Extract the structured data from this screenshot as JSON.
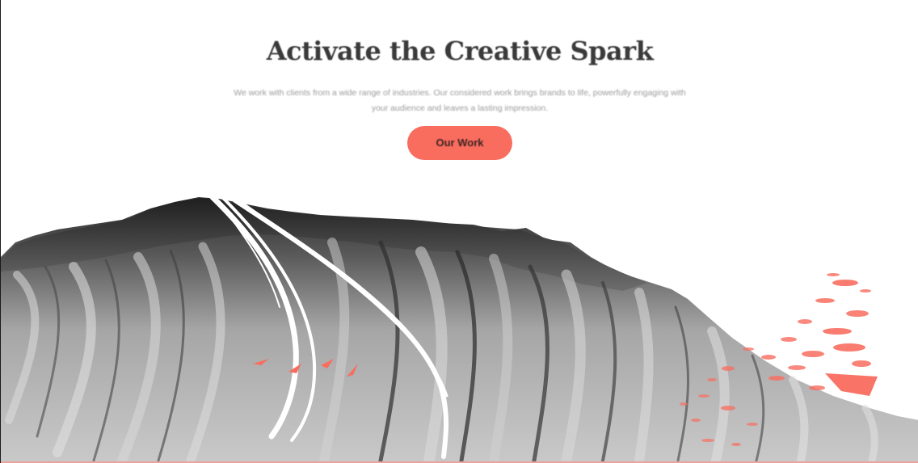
{
  "hero": {
    "headline": "Activate the Creative Spark",
    "subtext": "We work with clients from a wide range of industries. Our considered work brings brands to life, powerfully engaging with your audience and leaves a lasting impression.",
    "cta_label": "Our Work"
  },
  "colors": {
    "accent": "#f96d5f",
    "headline_text": "#3a3a3a",
    "body_text": "#9a9a9a",
    "background": "#ffffff"
  },
  "artwork": {
    "subject": "mountain-photo",
    "overlay_marks": [
      "white-brush-strokes",
      "coral-paint-splatter"
    ]
  }
}
